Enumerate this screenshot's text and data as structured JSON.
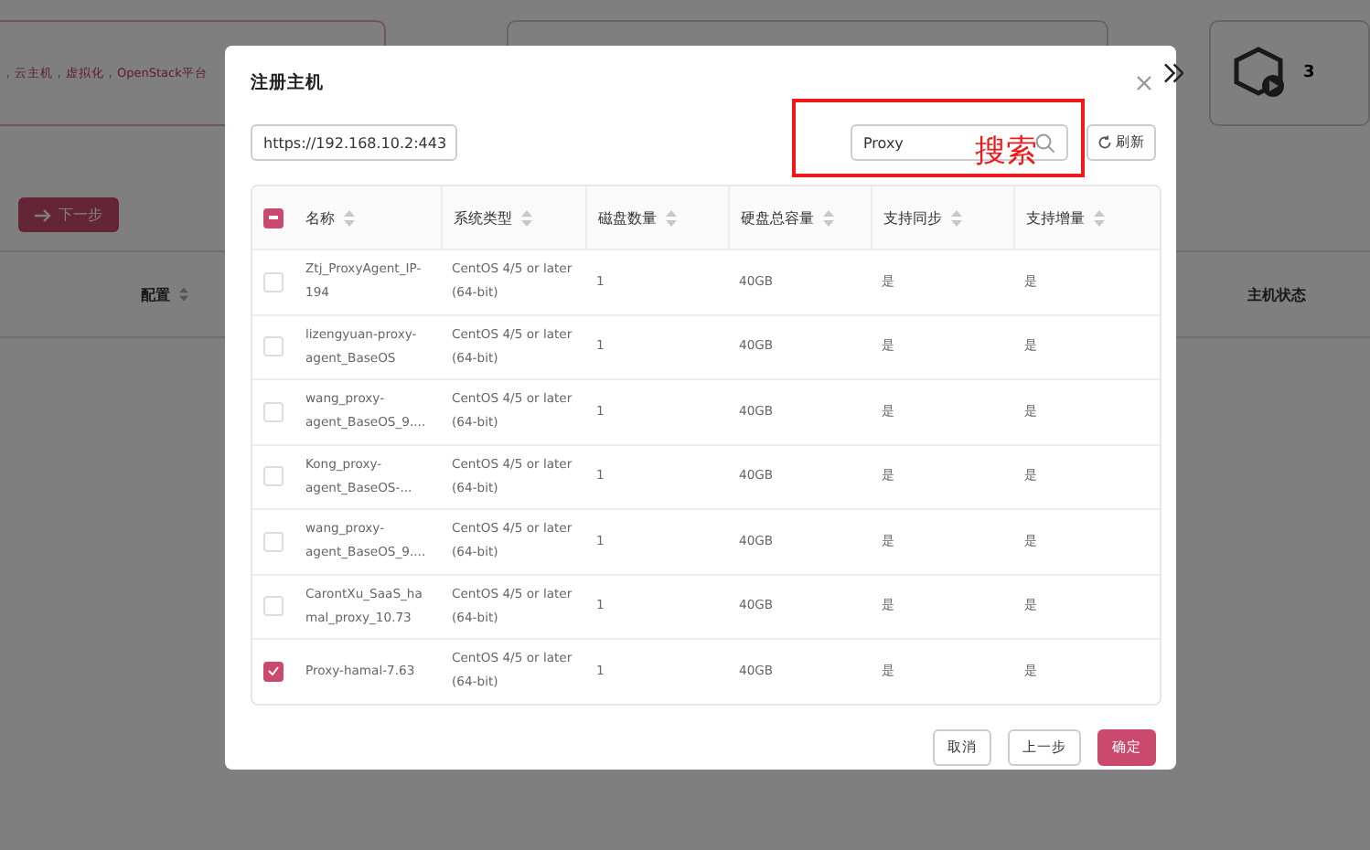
{
  "background": {
    "step_one_text": "，云主机，虚拟化，OpenStack平台",
    "step_three_number": "3",
    "next_button": "下一步",
    "columns": [
      {
        "label": "配置"
      },
      {
        "label": "主机状态"
      }
    ]
  },
  "dialog": {
    "title": "注册主机",
    "endpoint": "https://192.168.10.2:443",
    "search": {
      "value": "Proxy"
    },
    "refresh_button": "刷新",
    "annotation": {
      "label": "搜索"
    },
    "table": {
      "all_checkbox": {
        "indeterminate": true
      },
      "columns": [
        "名称",
        "系统类型",
        "磁盘数量",
        "硬盘总容量",
        "支持同步",
        "支持增量"
      ],
      "rows": [
        {
          "selected": false,
          "cells": [
            "Ztj_ProxyAgent_IP-194",
            "CentOS 4/5 or later (64-bit)",
            "1",
            "40GB",
            "是",
            "是"
          ]
        },
        {
          "selected": false,
          "cells": [
            "lizengyuan-proxy-agent_BaseOS",
            "CentOS 4/5 or later (64-bit)",
            "1",
            "40GB",
            "是",
            "是"
          ]
        },
        {
          "selected": false,
          "cells": [
            "wang_proxy-agent_BaseOS_9....",
            "CentOS 4/5 or later (64-bit)",
            "1",
            "40GB",
            "是",
            "是"
          ]
        },
        {
          "selected": false,
          "cells": [
            "Kong_proxy-agent_BaseOS-...",
            "CentOS 4/5 or later (64-bit)",
            "1",
            "40GB",
            "是",
            "是"
          ]
        },
        {
          "selected": false,
          "cells": [
            "wang_proxy-agent_BaseOS_9....",
            "CentOS 4/5 or later (64-bit)",
            "1",
            "40GB",
            "是",
            "是"
          ]
        },
        {
          "selected": false,
          "cells": [
            "CarontXu_SaaS_hamal_proxy_10.73",
            "CentOS 4/5 or later (64-bit)",
            "1",
            "40GB",
            "是",
            "是"
          ]
        },
        {
          "selected": true,
          "cells": [
            "Proxy-hamal-7.63",
            "CentOS 4/5 or later (64-bit)",
            "1",
            "40GB",
            "是",
            "是"
          ]
        }
      ]
    },
    "buttons": [
      {
        "label": "取消",
        "kind": "default"
      },
      {
        "label": "上一步",
        "kind": "default"
      },
      {
        "label": "确定",
        "kind": "primary"
      }
    ]
  }
}
